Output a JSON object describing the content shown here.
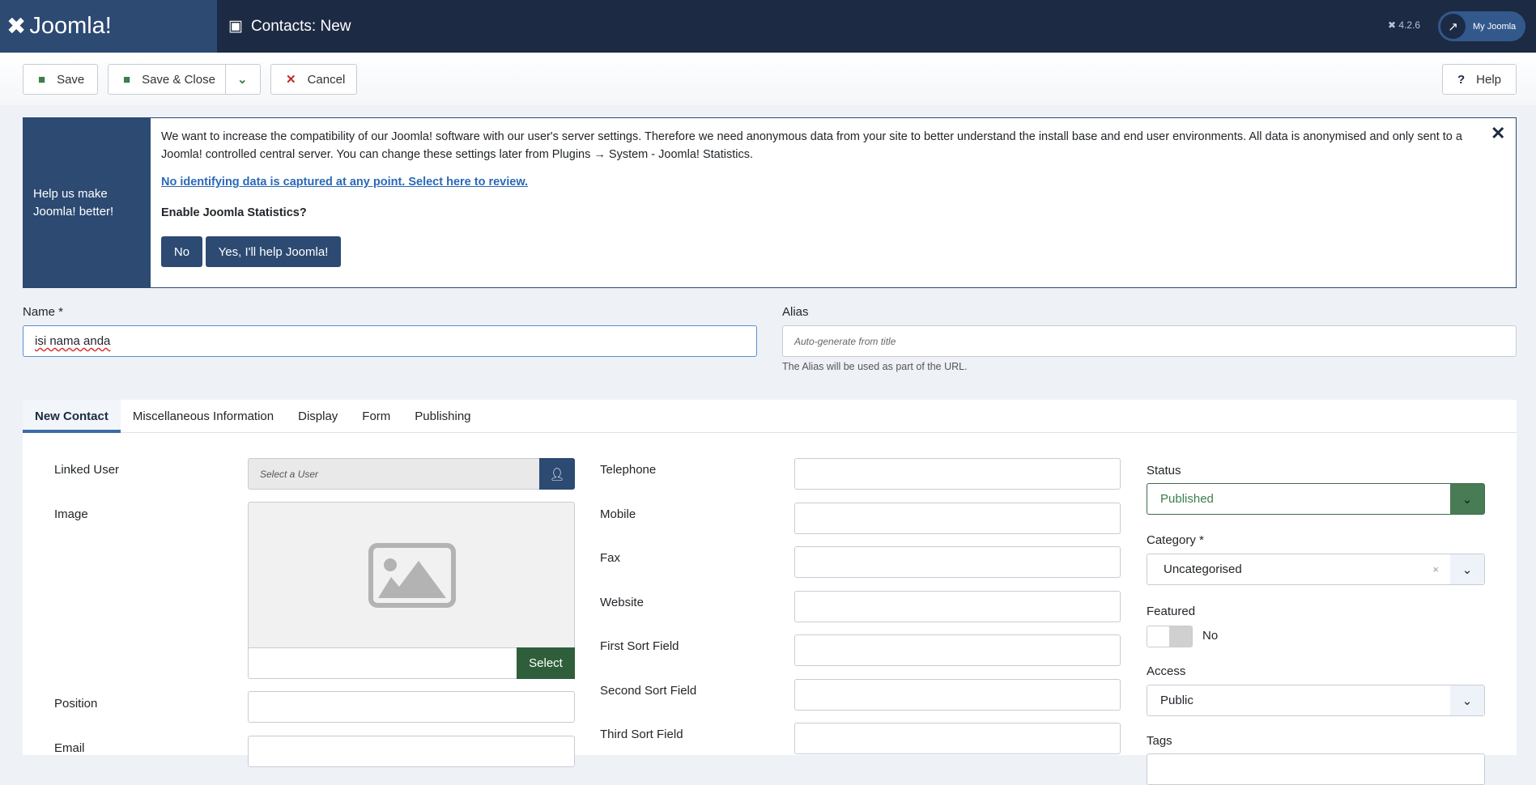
{
  "header": {
    "logo": "Joomla!",
    "title": "Contacts: New",
    "version": "4.2.6",
    "my_joomla": "My Joomla"
  },
  "toolbar": {
    "save": "Save",
    "save_close": "Save & Close",
    "cancel": "Cancel",
    "help": "Help"
  },
  "banner": {
    "side": "Help us make Joomla! better!",
    "text": "We want to increase the compatibility of our Joomla! software with our user's server settings. Therefore we need anonymous data from your site to better understand the install base and end user environments. All data is anonymised and only sent to a Joomla! controlled central server. You can change these settings later from Plugins → System - Joomla! Statistics.",
    "link": "No identifying data is captured at any point. Select here to review.",
    "question": "Enable Joomla Statistics?",
    "no": "No",
    "yes": "Yes, I'll help Joomla!"
  },
  "form": {
    "name_label": "Name *",
    "name_value": "isi nama anda",
    "alias_label": "Alias",
    "alias_placeholder": "Auto-generate from title",
    "alias_help": "The Alias will be used as part of the URL."
  },
  "tabs": [
    "New Contact",
    "Miscellaneous Information",
    "Display",
    "Form",
    "Publishing"
  ],
  "col1": {
    "linked_user": "Linked User",
    "user_placeholder": "Select a User",
    "image": "Image",
    "select": "Select",
    "position": "Position",
    "email": "Email"
  },
  "col2": [
    "Telephone",
    "Mobile",
    "Fax",
    "Website",
    "First Sort Field",
    "Second Sort Field",
    "Third Sort Field"
  ],
  "col3": {
    "status_label": "Status",
    "status": "Published",
    "category_label": "Category *",
    "category": "Uncategorised",
    "clear": "×",
    "featured_label": "Featured",
    "featured": "No",
    "access_label": "Access",
    "access": "Public",
    "tags_label": "Tags"
  },
  "colors": {
    "header": "#1c2a44",
    "brand": "#2c4a72",
    "success": "#3d7e4d"
  }
}
